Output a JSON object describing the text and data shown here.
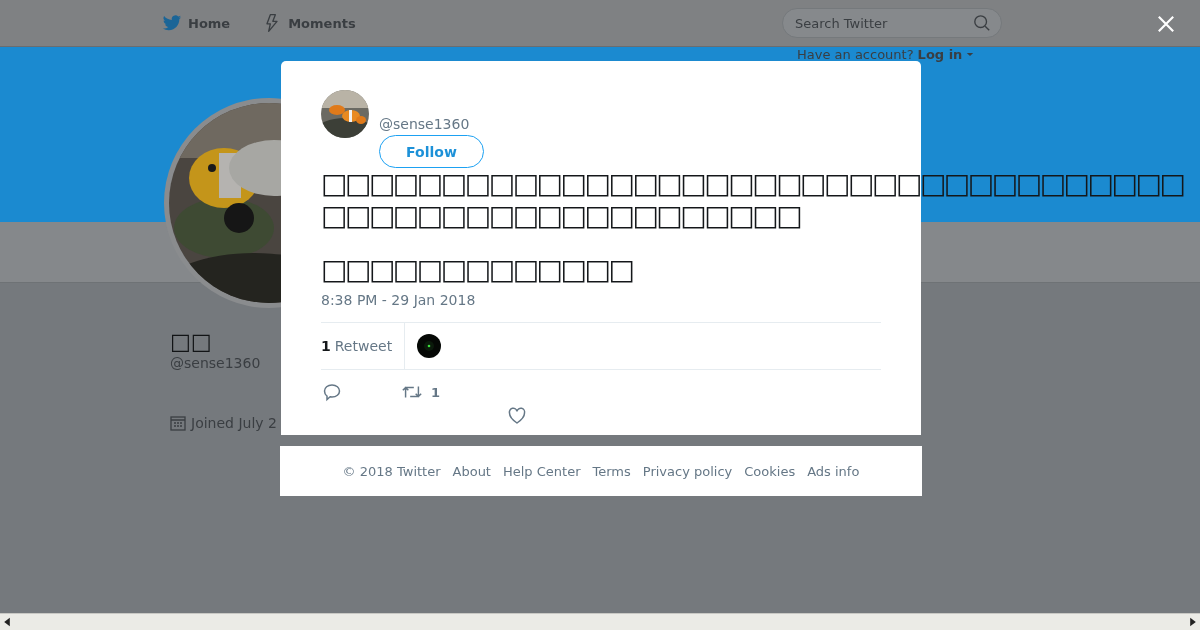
{
  "header": {
    "nav": [
      {
        "label": "Home"
      },
      {
        "label": "Moments"
      }
    ],
    "search": {
      "placeholder": "Search Twitter"
    },
    "account_prompt": "Have an account?",
    "login": "Log in"
  },
  "profile": {
    "name": "□□",
    "handle": "@sense1360",
    "joined": "Joined July 2"
  },
  "tweet": {
    "handle": "@sense1360",
    "follow": "Follow",
    "paragraphs": [
      [
        "□□□□□□□□□□□□□□□□□□□□□□□□□□□□□□□□□□□□",
        "□□□□□□□□□□□□□□□□□□□□"
      ],
      [
        "□□□□□□□□□□□□□"
      ]
    ],
    "timestamp": "8:38 PM - 29 Jan 2018",
    "retweet_count": "1",
    "retweet_label": "Retweet",
    "action_retweet_count": "1"
  },
  "footer": [
    "© 2018 Twitter",
    "About",
    "Help Center",
    "Terms",
    "Privacy policy",
    "Cookies",
    "Ads info"
  ]
}
